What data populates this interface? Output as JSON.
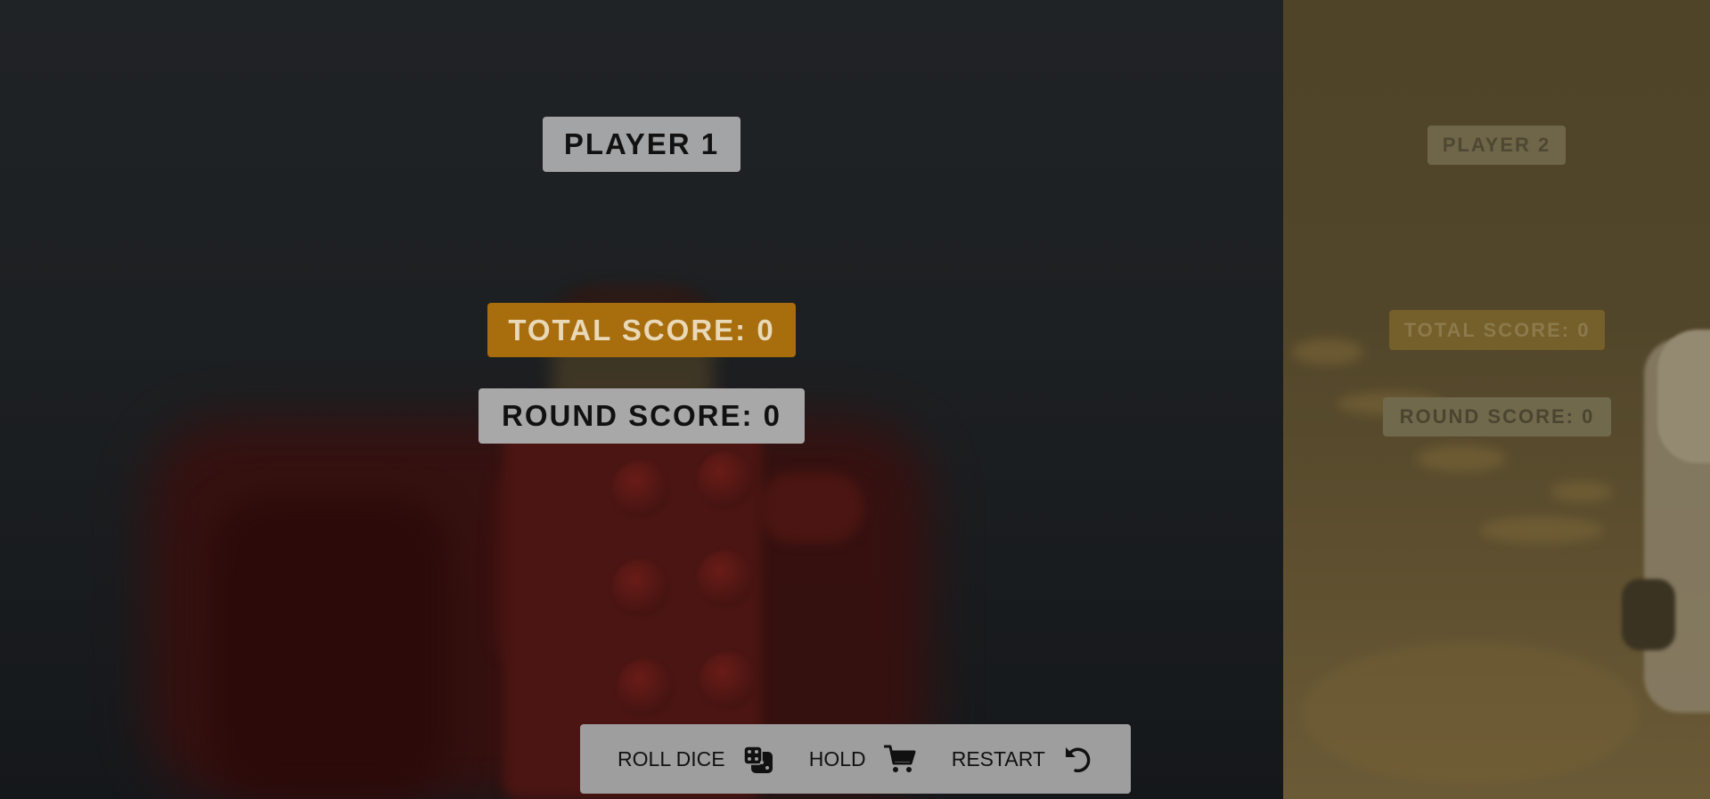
{
  "player1": {
    "name": "PLAYER 1",
    "total_score_label": "TOTAL SCORE: 0",
    "round_score_label": "ROUND SCORE: 0",
    "active": true
  },
  "player2": {
    "name": "PLAYER 2",
    "total_score_label": "TOTAL SCORE: 0",
    "round_score_label": "ROUND SCORE: 0",
    "active": false
  },
  "controls": {
    "roll_label": "ROLL DICE",
    "roll_icon": "dice-icon",
    "hold_label": "HOLD",
    "hold_icon": "cart-icon",
    "restart_label": "RESTART",
    "restart_icon": "undo-icon"
  },
  "colors": {
    "player1_bg": "#1d2022",
    "player2_bg": "#52462a",
    "total_score_bg": "#a86d0c",
    "label_bg": "#a3a4a5",
    "controls_bg": "#9e9e9f"
  }
}
